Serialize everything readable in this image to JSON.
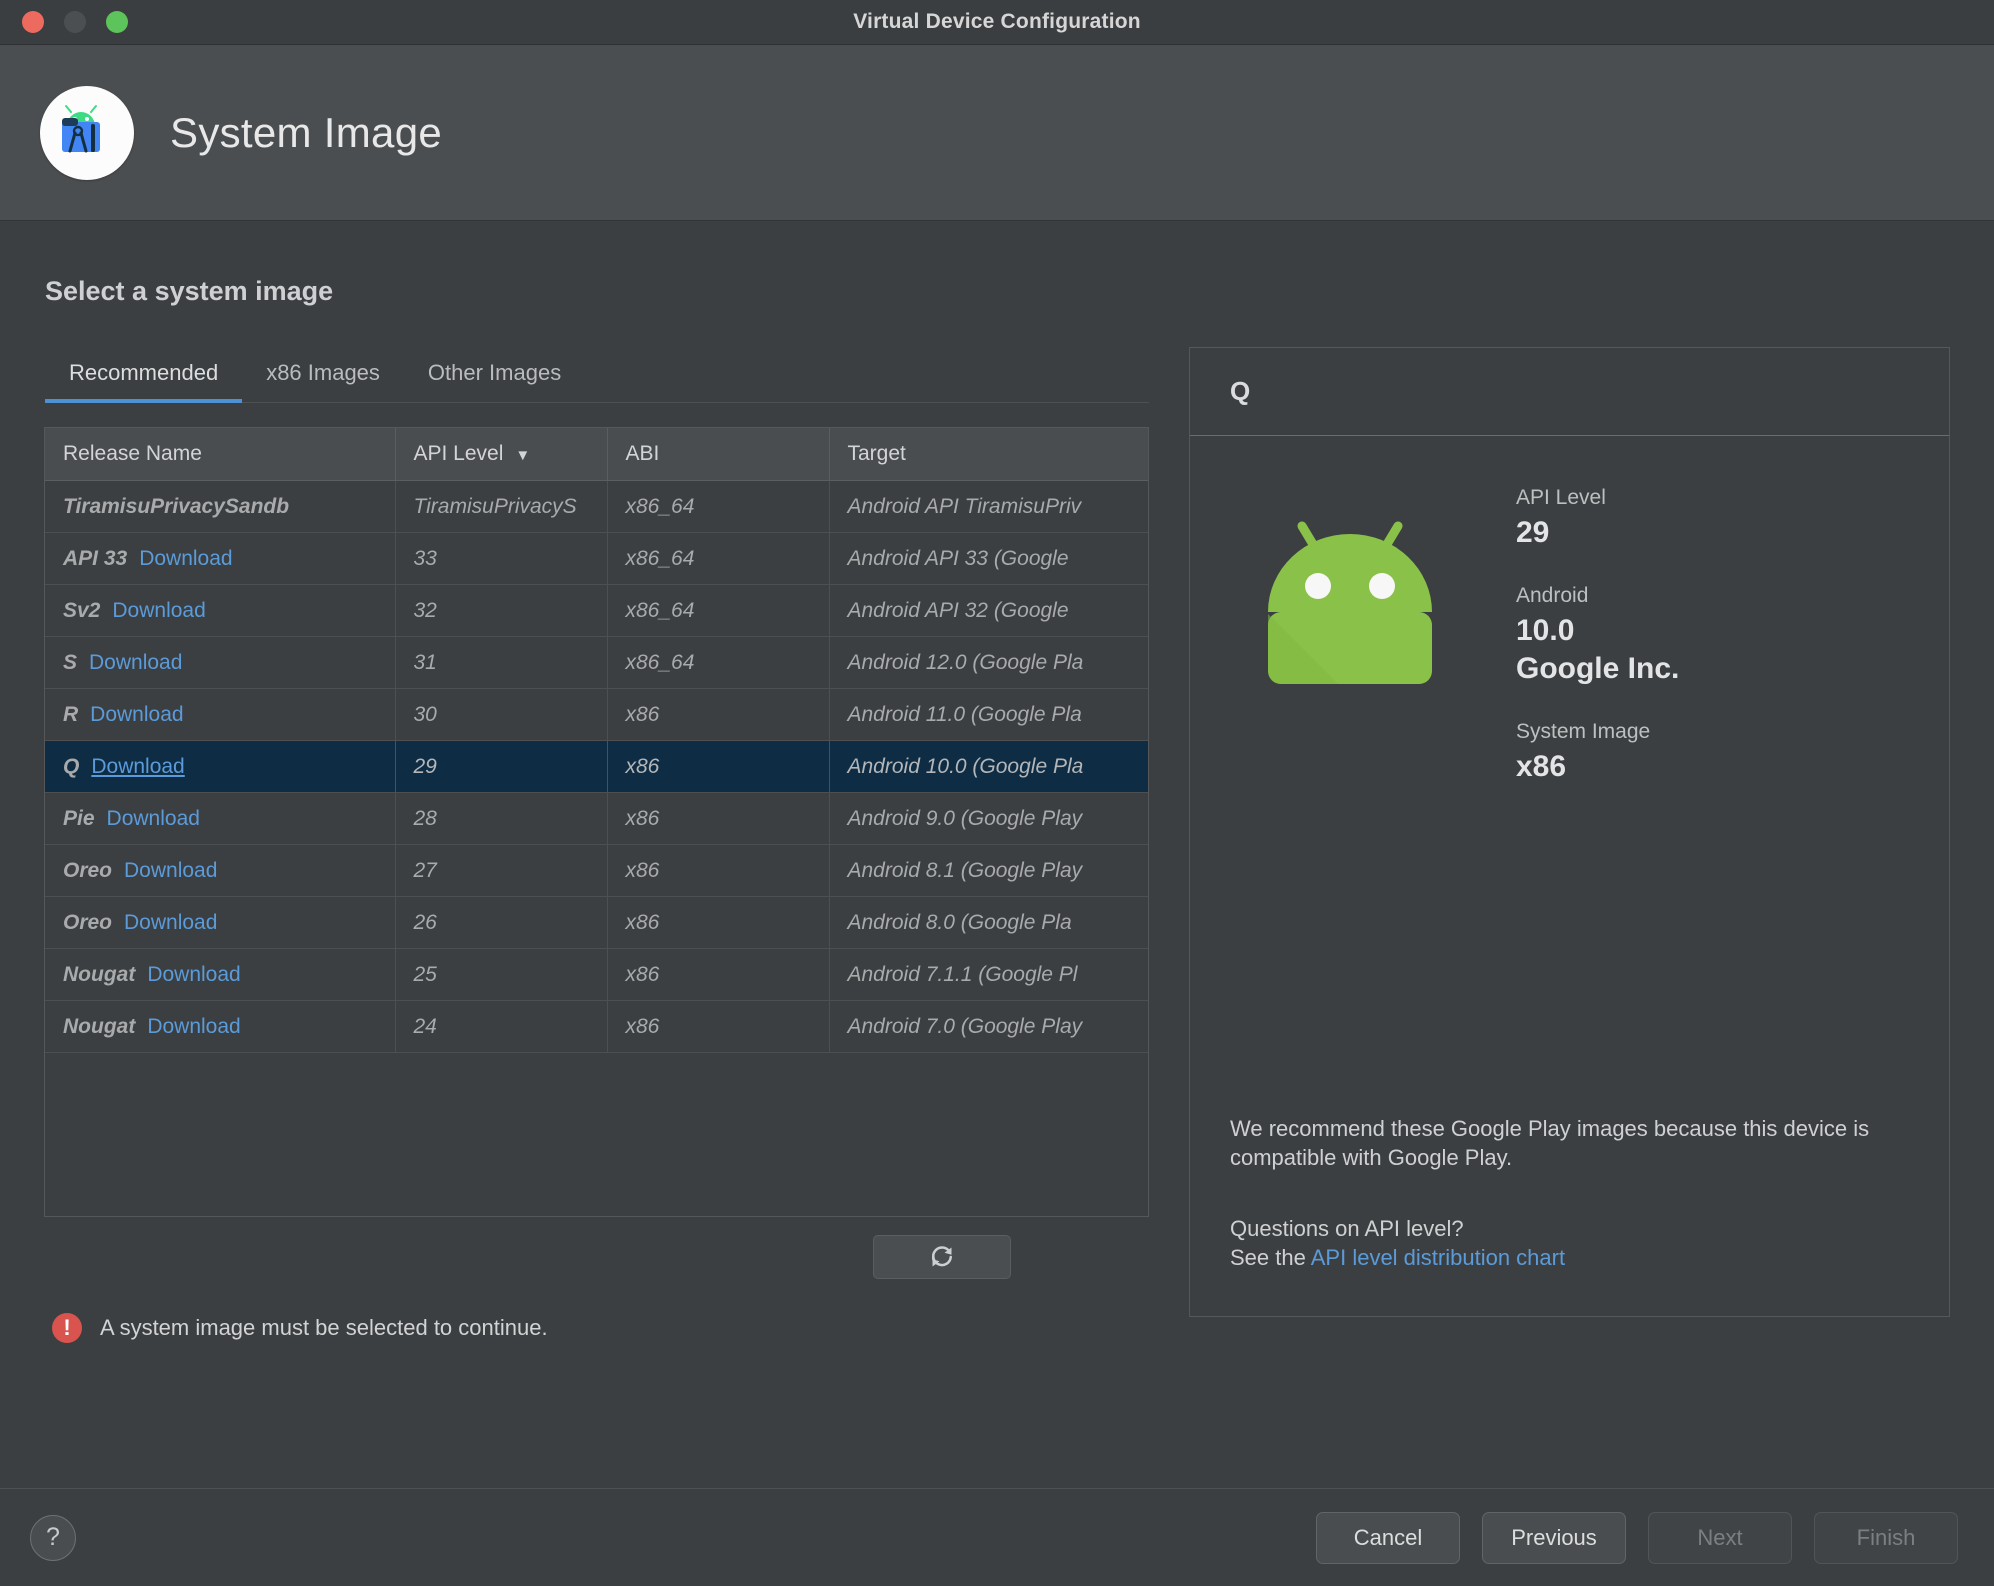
{
  "window": {
    "title": "Virtual Device Configuration",
    "traffic_lights": [
      "close-red",
      "minimize-gray",
      "zoom-green"
    ]
  },
  "header": {
    "icon": "android-studio-icon",
    "title": "System Image"
  },
  "main": {
    "section_title": "Select a system image",
    "tabs": [
      {
        "label": "Recommended",
        "active": true
      },
      {
        "label": "x86 Images",
        "active": false
      },
      {
        "label": "Other Images",
        "active": false
      }
    ],
    "table": {
      "columns": [
        "Release Name",
        "API Level",
        "ABI",
        "Target"
      ],
      "sorted_column": "API Level",
      "sort_indicator": "▼",
      "rows": [
        {
          "release": "TiramisuPrivacySandb",
          "download": "",
          "api": "TiramisuPrivacyS",
          "abi": "x86_64",
          "target": "Android API TiramisuPriv",
          "selected": false
        },
        {
          "release": "API 33",
          "download": "Download",
          "api": "33",
          "abi": "x86_64",
          "target": "Android API 33 (Google",
          "selected": false
        },
        {
          "release": "Sv2",
          "download": "Download",
          "api": "32",
          "abi": "x86_64",
          "target": "Android API 32 (Google",
          "selected": false
        },
        {
          "release": "S",
          "download": "Download",
          "api": "31",
          "abi": "x86_64",
          "target": "Android 12.0 (Google Pla",
          "selected": false
        },
        {
          "release": "R",
          "download": "Download",
          "api": "30",
          "abi": "x86",
          "target": "Android 11.0 (Google Pla",
          "selected": false
        },
        {
          "release": "Q",
          "download": "Download",
          "api": "29",
          "abi": "x86",
          "target": "Android 10.0 (Google Pla",
          "selected": true
        },
        {
          "release": "Pie",
          "download": "Download",
          "api": "28",
          "abi": "x86",
          "target": "Android 9.0 (Google Play",
          "selected": false
        },
        {
          "release": "Oreo",
          "download": "Download",
          "api": "27",
          "abi": "x86",
          "target": "Android 8.1 (Google Play",
          "selected": false
        },
        {
          "release": "Oreo",
          "download": "Download",
          "api": "26",
          "abi": "x86",
          "target": "Android 8.0 (Google Pla",
          "selected": false
        },
        {
          "release": "Nougat",
          "download": "Download",
          "api": "25",
          "abi": "x86",
          "target": "Android 7.1.1 (Google Pl",
          "selected": false
        },
        {
          "release": "Nougat",
          "download": "Download",
          "api": "24",
          "abi": "x86",
          "target": "Android 7.0 (Google Play",
          "selected": false
        }
      ]
    },
    "refresh_button": {
      "icon": "refresh-icon",
      "label": ""
    },
    "error": {
      "icon": "error-icon",
      "message": "A system image must be selected to continue."
    }
  },
  "detail": {
    "heading": "Q",
    "image": "android-robot-icon",
    "specs": [
      {
        "label": "API Level",
        "value": "29"
      },
      {
        "label": "Android",
        "value": "10.0"
      },
      {
        "label": "",
        "value": "Google Inc."
      },
      {
        "label": "System Image",
        "value": "x86"
      }
    ],
    "recommendation": "We recommend these Google Play images because this device is compatible with Google Play.",
    "question": "Questions on API level?",
    "see_the": "See the",
    "link": "API level distribution chart"
  },
  "footer": {
    "help_label": "?",
    "buttons": [
      {
        "label": "Cancel",
        "disabled": false
      },
      {
        "label": "Previous",
        "disabled": false
      },
      {
        "label": "Next",
        "disabled": true
      },
      {
        "label": "Finish",
        "disabled": true
      }
    ]
  },
  "colors": {
    "accent_blue": "#4d90d4",
    "link_blue": "#5b9bd9",
    "selection": "#0e2d45",
    "error_red": "#d9544e",
    "android_green": "#8ac249"
  }
}
